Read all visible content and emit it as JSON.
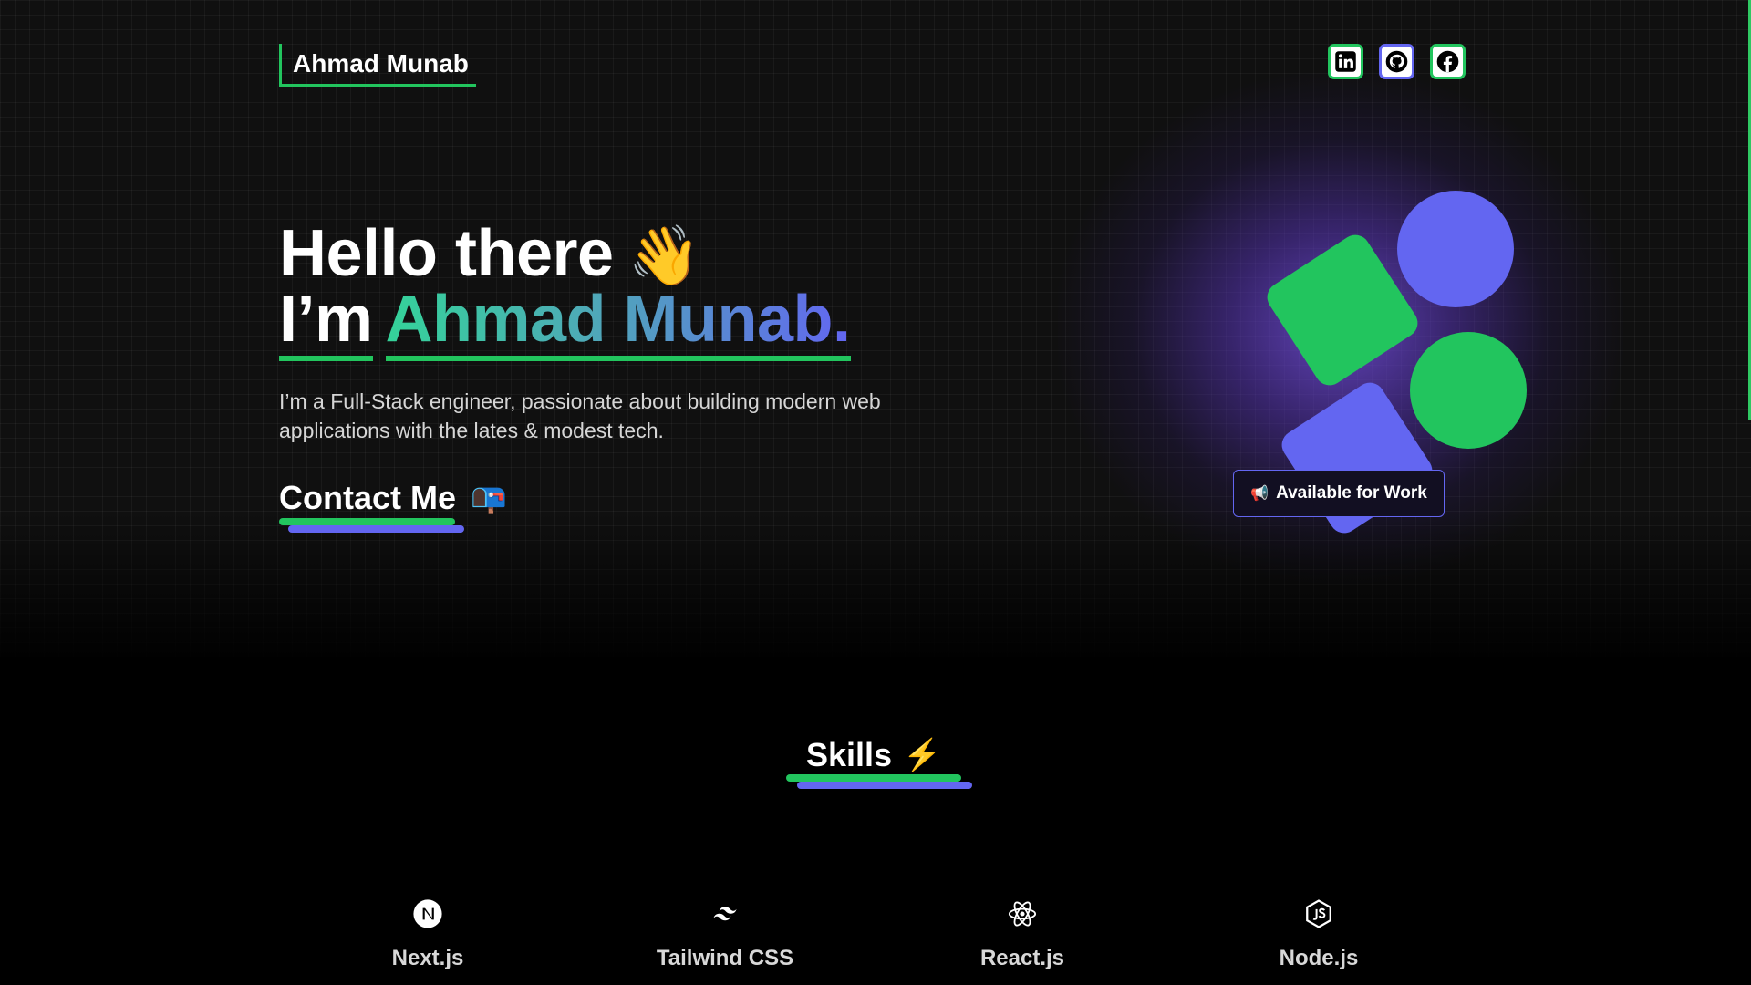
{
  "header": {
    "logo": "Ahmad Munab",
    "socials": [
      {
        "name": "LinkedIn",
        "icon": "linkedin-icon"
      },
      {
        "name": "GitHub",
        "icon": "github-icon"
      },
      {
        "name": "Facebook",
        "icon": "facebook-icon"
      }
    ]
  },
  "hero": {
    "greeting": "Hello there",
    "greeting_emoji": "👋",
    "intro_prefix": "I’m",
    "intro_name": "Ahmad Munab.",
    "bio": "I’m a Full-Stack engineer, passionate about building modern web applications with the lates & modest tech.",
    "contact_label": "Contact Me",
    "contact_emoji": "📭",
    "badge_emoji": "📢",
    "badge_label": "Available for Work"
  },
  "skills": {
    "title": "Skills",
    "title_emoji": "⚡",
    "items": [
      {
        "label": "Next.js",
        "icon": "nextjs-icon"
      },
      {
        "label": "Tailwind CSS",
        "icon": "tailwind-icon"
      },
      {
        "label": "React.js",
        "icon": "react-icon"
      },
      {
        "label": "Node.js",
        "icon": "nodejs-icon"
      }
    ]
  },
  "colors": {
    "accent_green": "#22c55e",
    "accent_indigo": "#6366f1",
    "background": "#101010"
  }
}
